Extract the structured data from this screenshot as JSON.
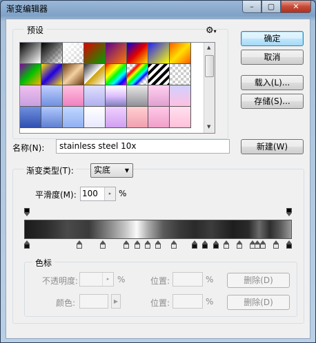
{
  "window": {
    "title": "渐变编辑器",
    "min": "–",
    "max": "▢",
    "close": "✕"
  },
  "presets": {
    "legend": "预设",
    "menu_icon": "gear-icon"
  },
  "buttons": {
    "ok": "确定",
    "cancel": "取消",
    "load": "载入(L)...",
    "save": "存储(S)...",
    "new": "新建(W)"
  },
  "name_row": {
    "label": "名称(N):",
    "value": "stainless steel 10x"
  },
  "gradient": {
    "type_label": "渐变类型(T):",
    "type_value": "实底",
    "smooth_label": "平滑度(M):",
    "smooth_value": "100",
    "smooth_unit": "%"
  },
  "stops": {
    "legend": "色标",
    "opacity_label": "不透明度:",
    "opacity_unit": "%",
    "position1_label": "位置:",
    "position1_unit": "%",
    "delete1": "删除(D)",
    "color_label": "颜色:",
    "position2_label": "位置:",
    "position2_unit": "%",
    "delete2": "删除(D)"
  },
  "opacity_stops": [
    0,
    100
  ],
  "color_stops": [
    0,
    20,
    29,
    38,
    42,
    46,
    50,
    56,
    64,
    68,
    72,
    76,
    81,
    86,
    88,
    90,
    95,
    100
  ]
}
